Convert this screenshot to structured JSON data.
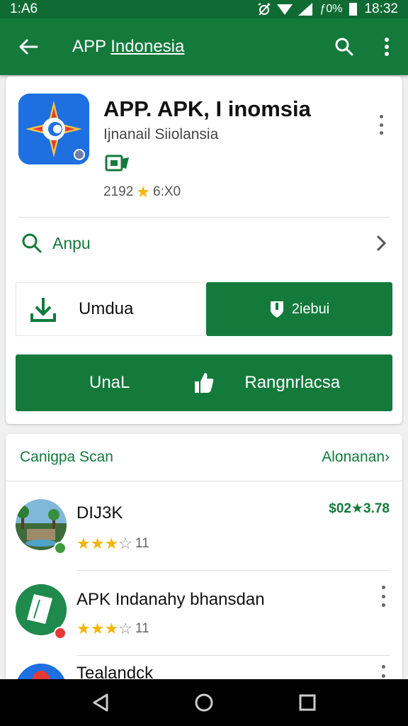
{
  "status": {
    "time_left": "1:A6",
    "battery": "ƒ0%",
    "time_right": "18:32"
  },
  "toolbar": {
    "title_prefix": "APP ",
    "title_link": "Indonesia"
  },
  "app": {
    "title": "APP. APK, I inomsia",
    "developer": "Ijnanail Siiolansia",
    "rating_count": "2192",
    "size": "6:X0"
  },
  "search_row": {
    "label": "Anpu"
  },
  "buttons": {
    "download": "Umdua",
    "secondary": "2iebui",
    "install_left": "UnaL",
    "install_right": "Rangnrlacsa"
  },
  "list": {
    "header_title": "Canigpa Scan",
    "header_more": "Alonanan›",
    "items": [
      {
        "title": "DIJ3K",
        "stars_full": "★★★",
        "stars_empty": "☆",
        "reviews": "11",
        "price": "$02★3.78"
      },
      {
        "title": "APK Indanahy bhansdan",
        "stars_full": "★★★",
        "stars_empty": "☆",
        "reviews": "11"
      },
      {
        "title": "Tealandck"
      }
    ]
  },
  "colors": {
    "primary": "#137a3c",
    "statusbar": "#0f6b33",
    "star": "#f4b400"
  }
}
